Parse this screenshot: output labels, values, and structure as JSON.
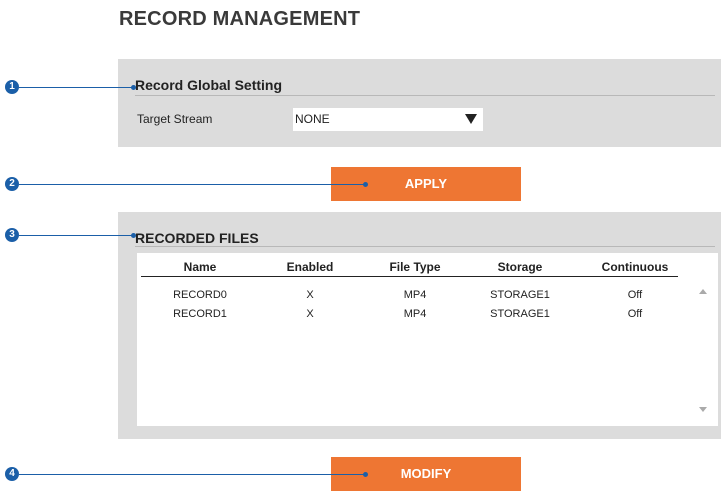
{
  "page_title": "RECORD MANAGEMENT",
  "global_setting": {
    "title": "Record Global Setting",
    "target_stream_label": "Target Stream",
    "target_stream_value": "NONE"
  },
  "apply_label": "APPLY",
  "recorded_files": {
    "title": "RECORDED FILES",
    "columns": [
      "Name",
      "Enabled",
      "File Type",
      "Storage",
      "Continuous"
    ],
    "rows": [
      [
        "RECORD0",
        "X",
        "MP4",
        "STORAGE1",
        "Off"
      ],
      [
        "RECORD1",
        "X",
        "MP4",
        "STORAGE1",
        "Off"
      ]
    ]
  },
  "modify_label": "MODIFY",
  "callouts": [
    "1",
    "2",
    "3",
    "4"
  ],
  "colors": {
    "accent": "#ee7633",
    "callout": "#1b5fa8",
    "panel": "#dcdcdc"
  }
}
